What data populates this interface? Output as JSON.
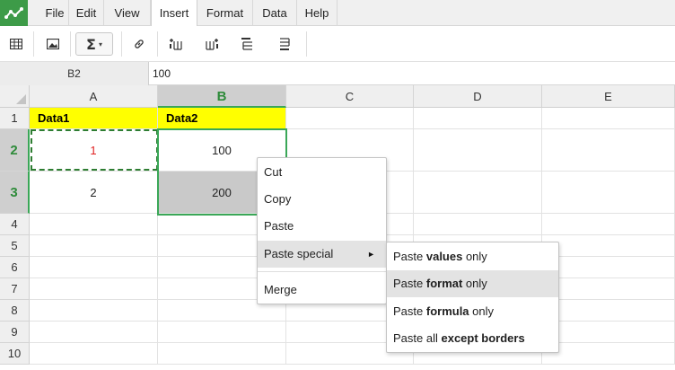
{
  "menubar": {
    "logo_icon": "spreadsheet-logo-icon",
    "items": [
      "File",
      "Edit",
      "View",
      "Insert",
      "Format",
      "Data",
      "Help"
    ],
    "active": "Insert"
  },
  "toolbar": {
    "buttons": [
      "table-icon",
      "image-icon",
      "sum-icon",
      "link-icon",
      "insert-column-before-icon",
      "insert-column-after-icon",
      "insert-row-above-icon",
      "insert-row-below-icon"
    ],
    "sigma_symbol": "Σ",
    "caret": "▾"
  },
  "formula_bar": {
    "cell_ref": "B2",
    "value": "100"
  },
  "grid": {
    "columns": [
      "A",
      "B",
      "C",
      "D",
      "E"
    ],
    "rows": [
      "1",
      "2",
      "3",
      "4",
      "5",
      "6",
      "7",
      "8",
      "9",
      "10"
    ],
    "selected_column": "B",
    "selected_rows": [
      "2",
      "3"
    ],
    "cells": {
      "A1": "Data1",
      "B1": "Data2",
      "A2": "1",
      "B2": "100",
      "A3": "2",
      "B3": "200"
    },
    "header_fill_color": "#ffff00",
    "value_color_a2": "#e02020",
    "selection_color": "#3aa757"
  },
  "context_menu": {
    "items": [
      "Cut",
      "Copy",
      "Paste",
      "Paste special",
      "Merge"
    ],
    "highlighted": "Paste special",
    "submenu_arrow": "►"
  },
  "submenu": {
    "items": [
      {
        "prefix": "Paste ",
        "bold": "values",
        "suffix": " only"
      },
      {
        "prefix": "Paste ",
        "bold": "format",
        "suffix": " only"
      },
      {
        "prefix": "Paste ",
        "bold": "formula",
        "suffix": " only"
      },
      {
        "prefix": "Paste all ",
        "bold": "except borders",
        "suffix": ""
      }
    ],
    "highlighted_index": 1
  }
}
